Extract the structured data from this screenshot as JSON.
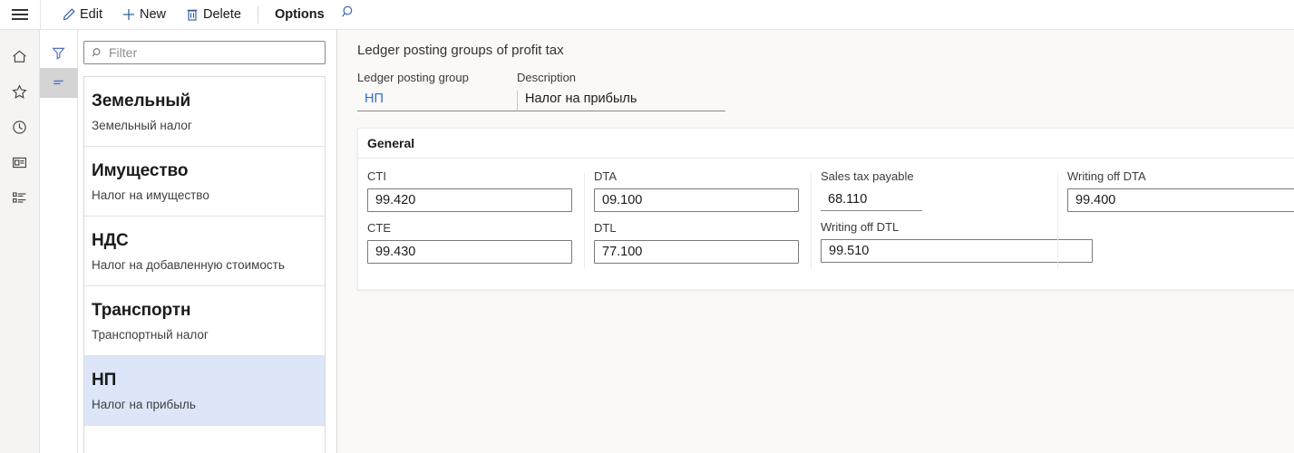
{
  "topbar": {
    "menu_icon": "hamburger-icon",
    "commands": [
      {
        "label": "Edit",
        "icon": "pencil-icon",
        "strong": false
      },
      {
        "label": "New",
        "icon": "plus-icon",
        "strong": false
      },
      {
        "label": "Delete",
        "icon": "trash-icon",
        "strong": false
      },
      {
        "label": "Options",
        "icon": "",
        "strong": true
      }
    ],
    "search_icon": "search-icon"
  },
  "navrail": {
    "items": [
      {
        "name": "home-icon",
        "label": "Home"
      },
      {
        "name": "star-icon",
        "label": "Favorites"
      },
      {
        "name": "clock-icon",
        "label": "Recent"
      },
      {
        "name": "workspace-icon",
        "label": "Workspaces"
      },
      {
        "name": "modules-icon",
        "label": "Modules"
      }
    ]
  },
  "listrail": {
    "filter_icon": "filter-icon",
    "sort_icon": "sort-lines-icon"
  },
  "listpane": {
    "filter": {
      "value": "",
      "placeholder": "Filter",
      "icon": "search-icon"
    },
    "items": [
      {
        "title": "Земельный",
        "subtitle": "Земельный налог",
        "selected": false
      },
      {
        "title": "Имущество",
        "subtitle": "Налог на имущество",
        "selected": false
      },
      {
        "title": "НДС",
        "subtitle": "Налог на добавленную стоимость",
        "selected": false
      },
      {
        "title": "Транспортн",
        "subtitle": "Транспортный налог",
        "selected": false
      },
      {
        "title": "НП",
        "subtitle": "Налог на прибыль",
        "selected": true
      }
    ]
  },
  "content": {
    "page_title": "Ledger posting groups of profit tax",
    "header_fields": [
      {
        "label": "Ledger posting group",
        "value": "НП",
        "style": "link"
      },
      {
        "label": "Description",
        "value": "Налог на прибыль",
        "style": "text"
      }
    ],
    "general": {
      "title": "General",
      "columns": [
        {
          "fields": [
            {
              "label": "CTI",
              "value": "99.420",
              "style": "boxed"
            },
            {
              "label": "CTE",
              "value": "99.430",
              "style": "boxed"
            }
          ]
        },
        {
          "fields": [
            {
              "label": "DTA",
              "value": "09.100",
              "style": "boxed"
            },
            {
              "label": "DTL",
              "value": "77.100",
              "style": "boxed"
            }
          ]
        },
        {
          "fields": [
            {
              "label": "Sales tax payable",
              "value": "68.110",
              "style": "flat"
            },
            {
              "label": "Writing off DTL",
              "value": "99.510",
              "style": "boxed-wide"
            }
          ]
        },
        {
          "fields": [
            {
              "label": "Writing off DTA",
              "value": "99.400",
              "style": "boxed-wide"
            }
          ]
        }
      ]
    }
  },
  "colors": {
    "accent": "#2b579a",
    "link": "#2e6fd4",
    "selection": "#dce6f8",
    "rail_bg": "#f5f4f2",
    "content_bg": "#faf9f8"
  }
}
